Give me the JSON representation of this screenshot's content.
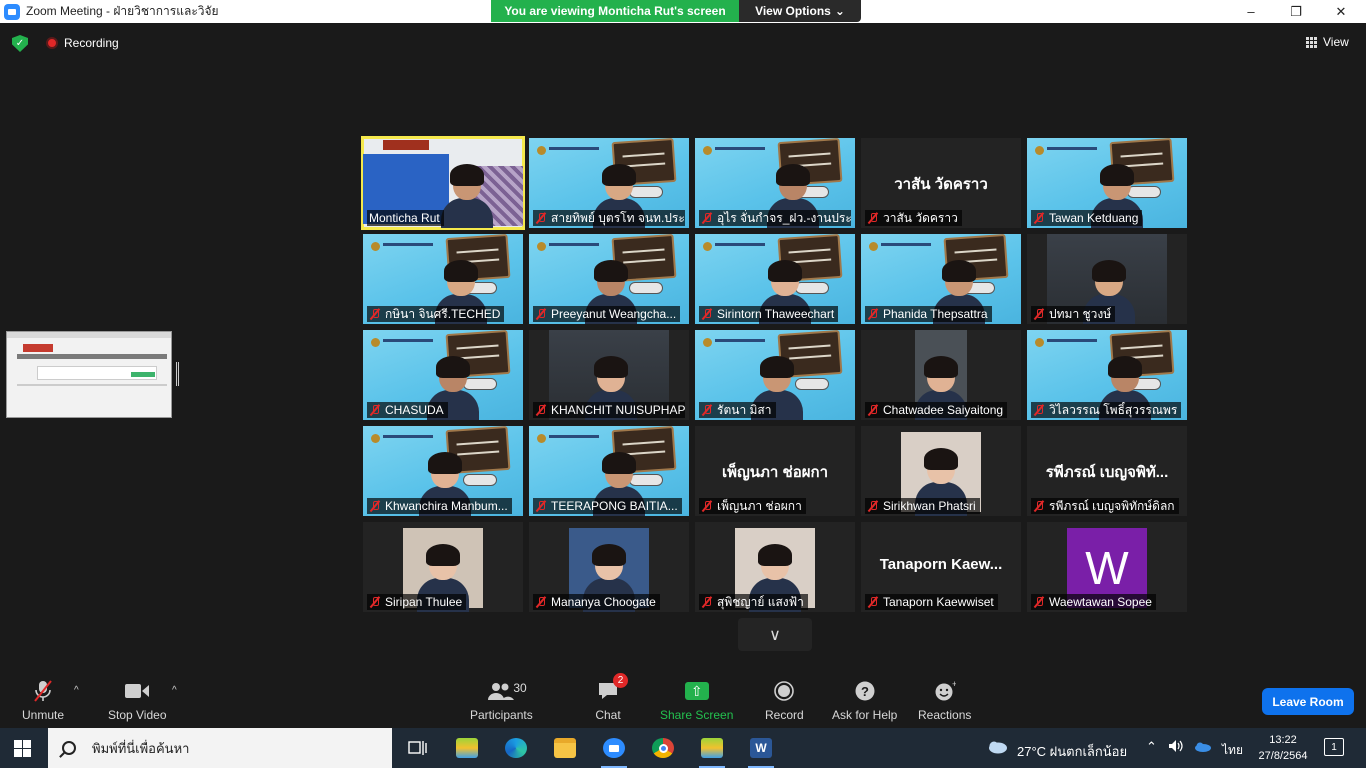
{
  "window": {
    "title": "Zoom Meeting - ฝ่ายวิชาการและวิจัย",
    "viewing_banner": "You are viewing Monticha Rut's screen",
    "view_options": "View Options"
  },
  "top": {
    "recording": "Recording",
    "view": "View"
  },
  "tiles": [
    {
      "name": "Monticha Rut",
      "muted": false
    },
    {
      "name": "สายทิพย์  บุตรโท จนท.ประ..."
    },
    {
      "name": "อุไร จั่นกำจร_ฝว.-งานประ..."
    },
    {
      "name": "วาสัน วัดคราว",
      "display_text": "วาสัน  วัดคราว"
    },
    {
      "name": "Tawan Ketduang"
    },
    {
      "name": "กษินา  จินศรี.TECHED"
    },
    {
      "name": "Preeyanut Weangcha..."
    },
    {
      "name": "Sirintorn Thaweechart"
    },
    {
      "name": "Phanida Thepsattra"
    },
    {
      "name": "ปทมา  ชูวงษ์"
    },
    {
      "name": "CHASUDA"
    },
    {
      "name": "KHANCHIT NUISUPHAP"
    },
    {
      "name": "รัตนา มิสา"
    },
    {
      "name": "Chatwadee Saiyaitong"
    },
    {
      "name": "วิไลวรรณ โพธิ์สุวรรณพร"
    },
    {
      "name": "Khwanchira Manbum..."
    },
    {
      "name": "TEERAPONG  BAITIA..."
    },
    {
      "name": "เพ็ญนภา ช่อผกา",
      "display_text": "เพ็ญนภา ช่อผกา"
    },
    {
      "name": "Sirikhwan Phatsri"
    },
    {
      "name": "รพีภรณ์ เบญจพิทักษ์ดิลก",
      "display_text": "รพีภรณ์ เบญจพิทั..."
    },
    {
      "name": "Siripan Thulee"
    },
    {
      "name": "Mananya Choogate"
    },
    {
      "name": "สุพิชญาย์ แสงฟ้า"
    },
    {
      "name": "Tanaporn Kaewwiset",
      "display_text": "Tanaporn  Kaew..."
    },
    {
      "name": "Waewtawan Sopee",
      "avatar_letter": "W"
    }
  ],
  "toolbar": {
    "unmute": "Unmute",
    "stop_video": "Stop Video",
    "participants": "Participants",
    "participants_count": "30",
    "chat": "Chat",
    "chat_badge": "2",
    "share_screen": "Share Screen",
    "record": "Record",
    "ask_for_help": "Ask for Help",
    "reactions": "Reactions",
    "leave_room": "Leave Room"
  },
  "taskbar": {
    "search_placeholder": "พิมพ์ที่นี่เพื่อค้นหา",
    "weather": "27°C  ฝนตกเล็กน้อย",
    "language": "ไทย",
    "time": "13:22",
    "date": "27/8/2564",
    "notifications": "1"
  },
  "colors": {
    "accent_green": "#23b14d",
    "leave_blue": "#0e72ed",
    "active_speaker": "#f5e94c",
    "mute_red": "#e02828"
  }
}
